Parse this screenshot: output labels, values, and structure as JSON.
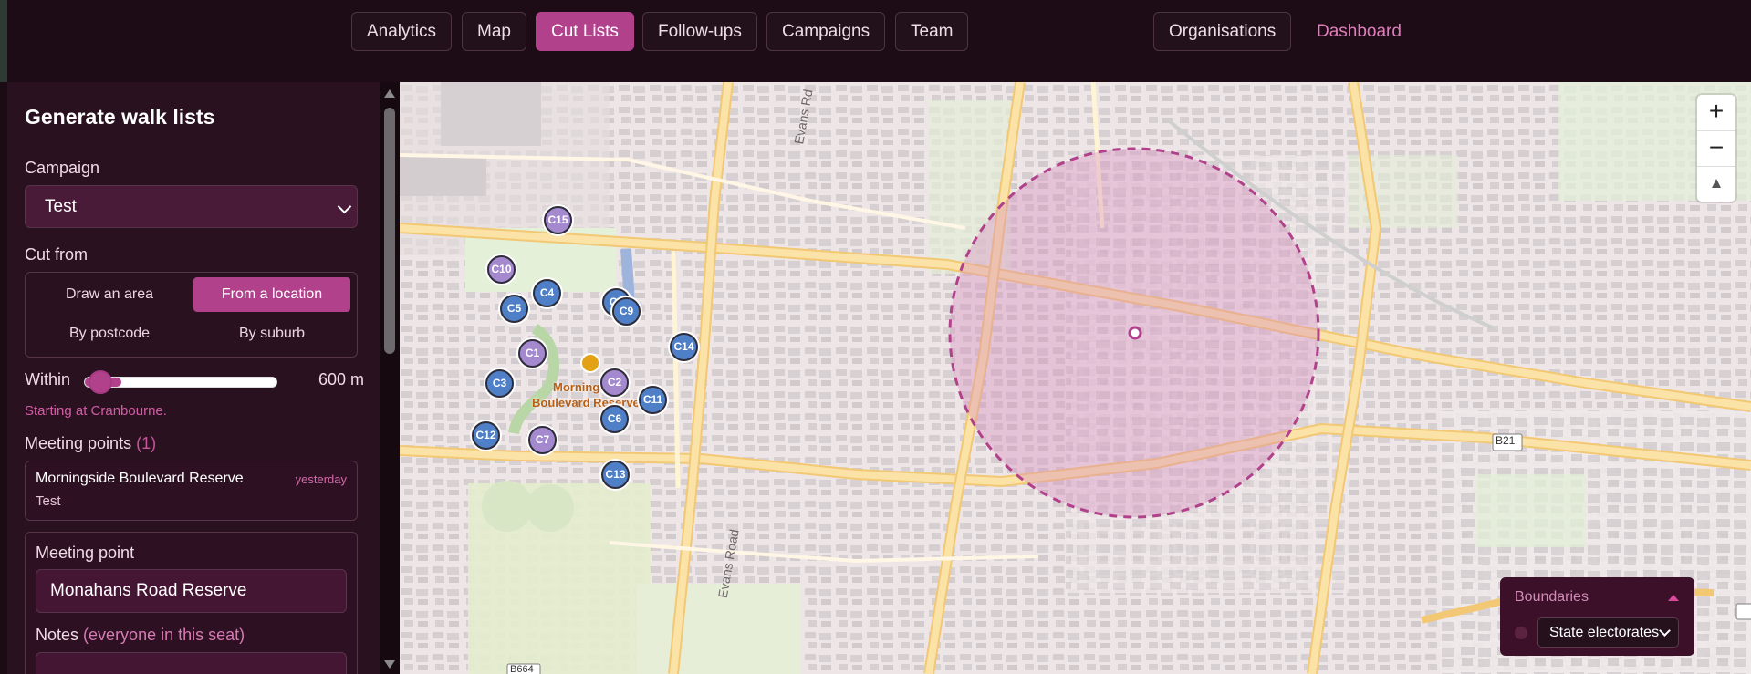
{
  "nav": {
    "analytics": "Analytics",
    "map": "Map",
    "cut_lists": "Cut Lists",
    "follow_ups": "Follow-ups",
    "campaigns": "Campaigns",
    "team": "Team",
    "organisations": "Organisations",
    "dashboard": "Dashboard"
  },
  "panel": {
    "title": "Generate walk lists",
    "campaign_label": "Campaign",
    "campaign_value": "Test",
    "cut_from_label": "Cut from",
    "options": {
      "draw_area": "Draw an area",
      "from_location": "From a location",
      "by_postcode": "By postcode",
      "by_suburb": "By suburb"
    },
    "within_label": "Within",
    "within_value": "600 m",
    "within_fraction": 0.19,
    "starting_text": "Starting at Cranbourne.",
    "meeting_points_label": "Meeting points",
    "meeting_points_count": "(1)",
    "meeting_point_item": {
      "name": "Morningside Boulevard Reserve",
      "time": "yesterday",
      "campaign": "Test"
    },
    "meeting_point_label": "Meeting point",
    "meeting_point_value": "Monahans Road Reserve",
    "notes_label": "Notes",
    "notes_hint": "(everyone in this seat)"
  },
  "map": {
    "road_labels": {
      "evans_top": "Evans Rd",
      "evans_bottom": "Evans Road",
      "b21": "B21",
      "b664": "B664"
    },
    "meeting_label_1": "Morningside",
    "meeting_label_2": "Boulevard Reserve",
    "cuts": {
      "C1": "C1",
      "C2": "C2",
      "C3": "C3",
      "C4": "C4",
      "C5": "C5",
      "C6": "C6",
      "C7": "C7",
      "C8": "C8",
      "C9": "C9",
      "C10": "C10",
      "C11": "C11",
      "C12": "C12",
      "C13": "C13",
      "C14": "C14",
      "C15": "C15"
    },
    "zoom_in": "+",
    "zoom_out": "−",
    "reset_north": "▲",
    "boundaries_title": "Boundaries",
    "boundaries_value": "State electorates",
    "colors": {
      "accent": "#b2418c",
      "cut_blue": "#4e7fc7",
      "cut_purple": "#a489cf",
      "radius_fill": "#d88bbc"
    }
  }
}
